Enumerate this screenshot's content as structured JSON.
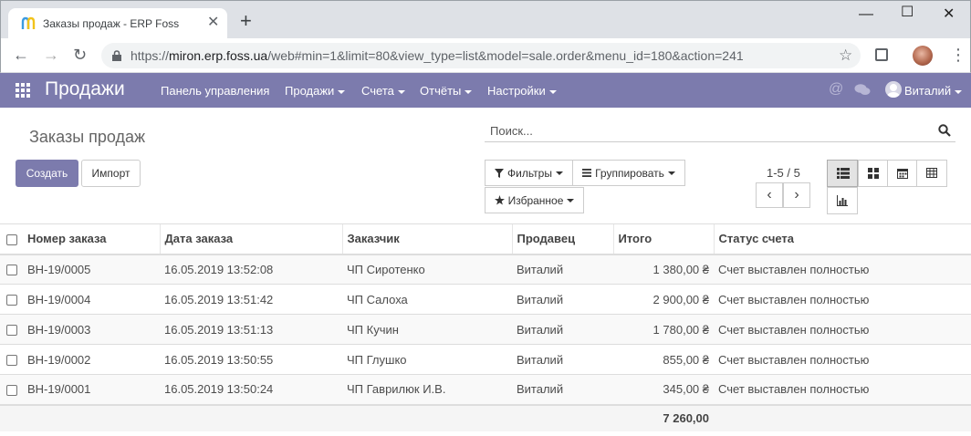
{
  "browser": {
    "tab_title": "Заказы продаж - ERP Foss",
    "url_host": "miron.erp.foss.ua",
    "url_path": "/web#min=1&limit=80&view_type=list&model=sale.order&menu_id=180&action=241",
    "url_scheme": "https://"
  },
  "topnav": {
    "brand": "Продажи",
    "items": [
      {
        "label": "Панель управления"
      },
      {
        "label": "Продажи"
      },
      {
        "label": "Счета"
      },
      {
        "label": "Отчёты"
      },
      {
        "label": "Настройки"
      }
    ],
    "user": "Виталий",
    "accent": "#7c7bad"
  },
  "control_panel": {
    "title": "Заказы продаж",
    "search_placeholder": "Поиск...",
    "create_label": "Создать",
    "import_label": "Импорт",
    "filters_label": "Фильтры",
    "groupby_label": "Группировать",
    "favorites_label": "Избранное",
    "pager": "1-5 / 5"
  },
  "table": {
    "columns": [
      "Номер заказа",
      "Дата заказа",
      "Заказчик",
      "Продавец",
      "Итого",
      "Статус счета"
    ],
    "rows": [
      {
        "number": "ВН-19/0005",
        "date": "16.05.2019 13:52:08",
        "customer": "ЧП Сиротенко",
        "salesperson": "Виталий",
        "total": "1 380,00 ₴",
        "status": "Счет выставлен полностью"
      },
      {
        "number": "ВН-19/0004",
        "date": "16.05.2019 13:51:42",
        "customer": "ЧП Салоха",
        "salesperson": "Виталий",
        "total": "2 900,00 ₴",
        "status": "Счет выставлен полностью"
      },
      {
        "number": "ВН-19/0003",
        "date": "16.05.2019 13:51:13",
        "customer": "ЧП Кучин",
        "salesperson": "Виталий",
        "total": "1 780,00 ₴",
        "status": "Счет выставлен полностью"
      },
      {
        "number": "ВН-19/0002",
        "date": "16.05.2019 13:50:55",
        "customer": "ЧП Глушко",
        "salesperson": "Виталий",
        "total": "855,00 ₴",
        "status": "Счет выставлен полностью"
      },
      {
        "number": "ВН-19/0001",
        "date": "16.05.2019 13:50:24",
        "customer": "ЧП Гаврилюк И.В.",
        "salesperson": "Виталий",
        "total": "345,00 ₴",
        "status": "Счет выставлен полностью"
      }
    ],
    "footer_total": "7 260,00"
  }
}
